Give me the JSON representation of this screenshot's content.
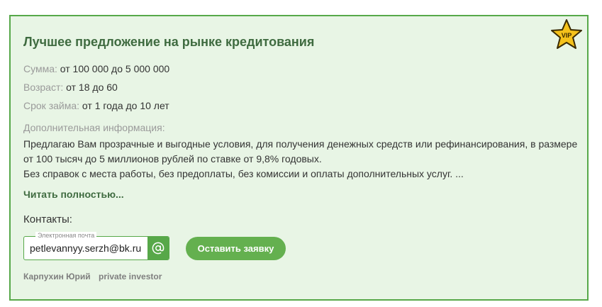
{
  "card": {
    "badge": "VIP",
    "title": "Лучшее предложение на рынке кредитования",
    "fields": [
      {
        "label": "Сумма:",
        "value": "от 100 000 до 5 000 000"
      },
      {
        "label": "Возраст:",
        "value": "от 18 до 60"
      },
      {
        "label": "Срок займа:",
        "value": "от 1 года до 10 лет"
      }
    ],
    "additional_label": "Дополнительная информация:",
    "description_lines": [
      "Предлагаю Вам прозрачные и выгодные условия, для получения денежных средств или рефинансирования, в размере",
      "от 100 тысяч до 5 миллионов рублей по ставке от 9,8% годовых.",
      "Без справок с места работы, без предоплаты, без комиссии и оплаты дополнительных услуг. ..."
    ],
    "read_more": "Читать полностью...",
    "contacts_label": "Контакты:",
    "email_legend": "Электронная почта",
    "email_value": "petlevannyy.serzh@bk.ru",
    "apply_button": "Оставить заявку",
    "author_name": "Карпухин Юрий",
    "author_role": "private investor",
    "colors": {
      "accent": "#57a849",
      "button": "#64b04f",
      "background": "#e8f5e5",
      "title": "#3f6b40",
      "star": "#f5c21b"
    }
  }
}
